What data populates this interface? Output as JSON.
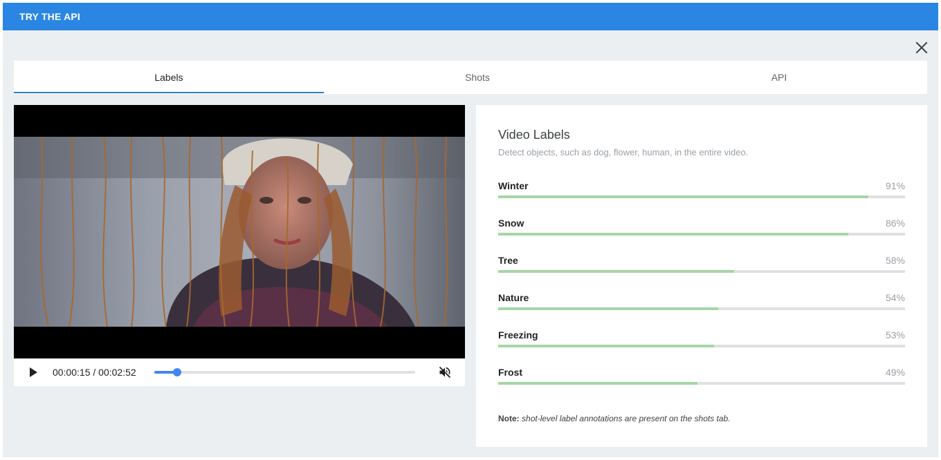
{
  "header": {
    "title": "TRY THE API"
  },
  "tabs": [
    {
      "label": "Labels",
      "active": true
    },
    {
      "label": "Shots",
      "active": false
    },
    {
      "label": "API",
      "active": false
    }
  ],
  "player": {
    "current_time": "00:00:15",
    "duration": "00:02:52",
    "progress": 0.087,
    "muted": true
  },
  "labels_panel": {
    "title": "Video Labels",
    "subtitle": "Detect objects, such as dog, flower, human, in the entire video.",
    "items": [
      {
        "name": "Winter",
        "percent": "91%",
        "value": 0.91
      },
      {
        "name": "Snow",
        "percent": "86%",
        "value": 0.86
      },
      {
        "name": "Tree",
        "percent": "58%",
        "value": 0.58
      },
      {
        "name": "Nature",
        "percent": "54%",
        "value": 0.54
      },
      {
        "name": "Freezing",
        "percent": "53%",
        "value": 0.53
      },
      {
        "name": "Frost",
        "percent": "49%",
        "value": 0.49
      }
    ],
    "note_label": "Note:",
    "note_text": "shot-level label annotations are present on the shots tab."
  },
  "colors": {
    "header": "#2b86e3",
    "accent": "#4285f4",
    "bar_fill": "#a5d6a7",
    "bar_track": "#e0e0e0"
  },
  "icons": {
    "close": "close-icon",
    "play": "play-icon",
    "mute": "volume-off-icon"
  }
}
